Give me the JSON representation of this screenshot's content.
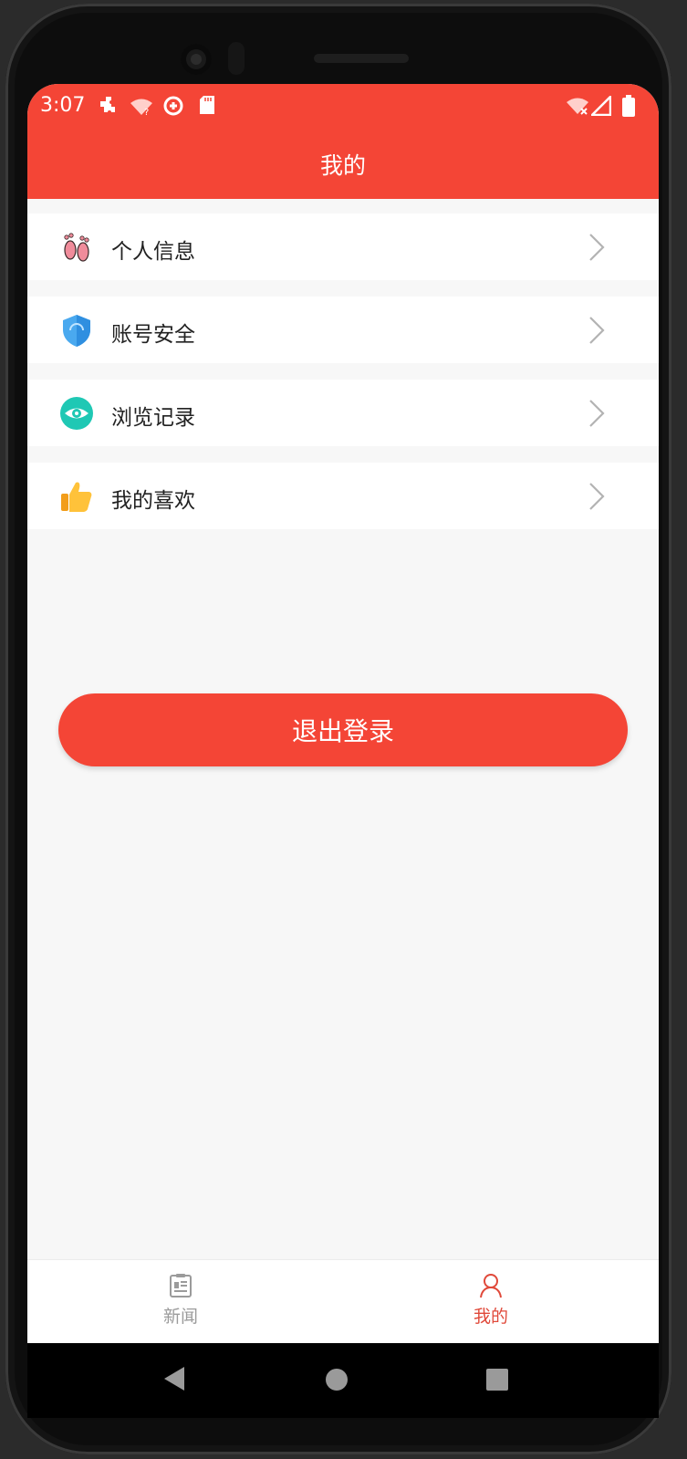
{
  "status_bar": {
    "time": "3:07",
    "left_icons": [
      "puzzle-icon",
      "wifi-question-icon",
      "data-saver-icon",
      "sd-card-icon"
    ],
    "right_icons": [
      "wifi-off-icon",
      "signal-icon",
      "battery-icon"
    ]
  },
  "header": {
    "title": "我的"
  },
  "menu": [
    {
      "label": "个人信息",
      "icon": "footprints-icon"
    },
    {
      "label": "账号安全",
      "icon": "shield-icon"
    },
    {
      "label": "浏览记录",
      "icon": "eye-icon"
    },
    {
      "label": "我的喜欢",
      "icon": "thumbs-up-icon"
    }
  ],
  "logout_label": "退出登录",
  "tabs": [
    {
      "label": "新闻",
      "icon": "news-icon",
      "active": false
    },
    {
      "label": "我的",
      "icon": "person-icon",
      "active": true
    }
  ],
  "colors": {
    "accent": "#f44536",
    "background": "#f7f7f7",
    "tab_inactive": "#9b9b9b",
    "tab_active": "#e0493a"
  },
  "nav_buttons": [
    "back-triangle-icon",
    "home-circle-icon",
    "recents-square-icon"
  ]
}
